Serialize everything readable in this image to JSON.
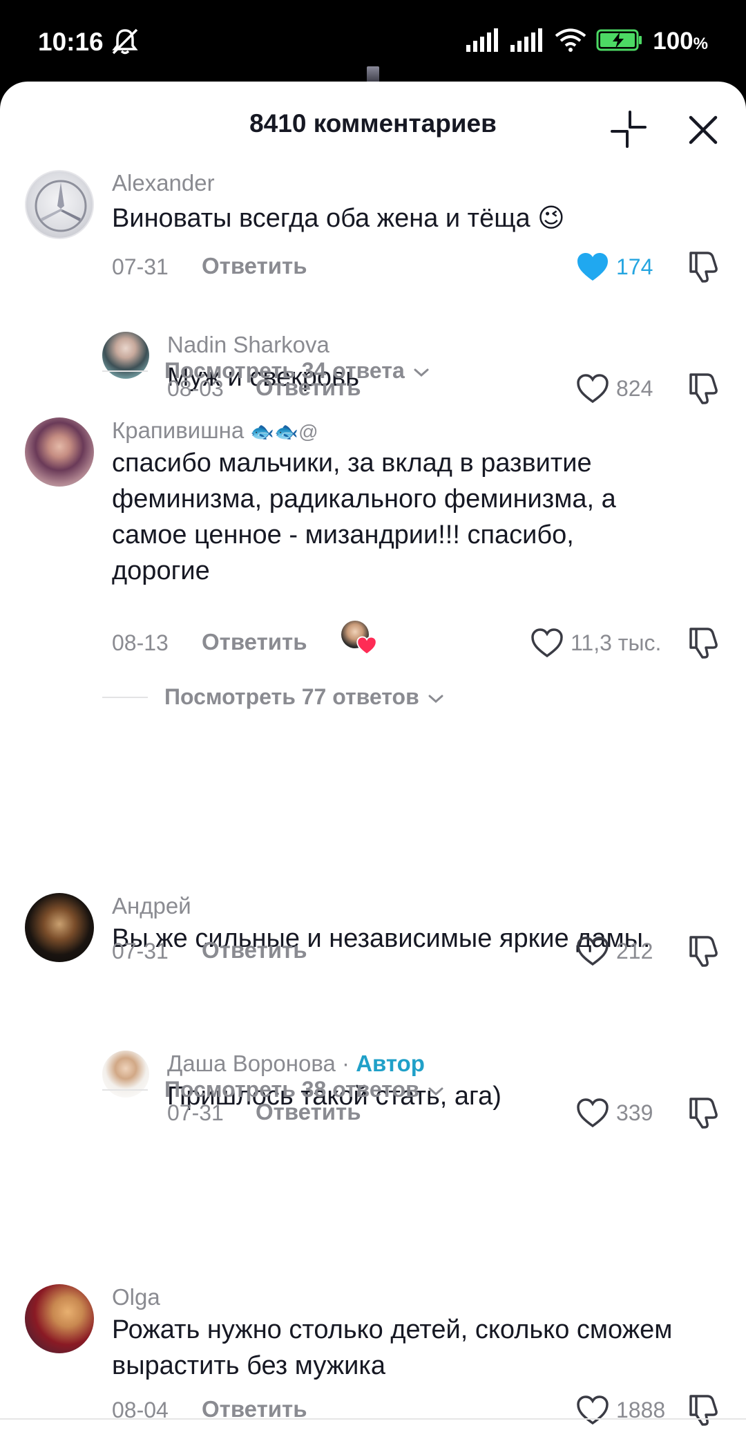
{
  "status": {
    "time": "10:16",
    "battery": "100",
    "battery_unit": "%"
  },
  "header": {
    "title": "8410 комментариев"
  },
  "reply_label": "Ответить",
  "comments": [
    {
      "user": "Alexander",
      "text": "Виноваты всегда оба жена и тёща 😉",
      "date": "07-31",
      "likes": "174",
      "liked": true
    },
    {
      "user": "Nadin Sharkova",
      "text": "Муж и свекровь",
      "date": "08-03",
      "likes": "824"
    },
    {
      "view_replies": "Посмотреть 34 ответа"
    },
    {
      "user": "Крапивишна",
      "user_suffix": "🐟🐟@",
      "text": "спасибо мальчики, за вклад в развитие феминизма, радикального феминизма, а самое ценное - мизандрии!!! спасибо, дорогие",
      "date": "08-13",
      "likes": "11,3 тыс."
    },
    {
      "view_replies": "Посмотреть 77 ответов"
    },
    {
      "user": "Андрей",
      "text": "Вы же сильные и независимые яркие дамы.",
      "date": "07-31",
      "likes": "212"
    },
    {
      "user": "Даша Воронова",
      "author_sep": " · ",
      "author_badge": "Автор",
      "text": "Пришлось такой стать, ага)",
      "date": "07-31",
      "likes": "339"
    },
    {
      "view_replies": "Посмотреть 38 ответов"
    },
    {
      "user": "Olga",
      "text": "Рожать нужно столько детей, сколько сможем вырастить без мужика",
      "date": "08-04",
      "likes": "1888"
    }
  ],
  "colors": {
    "accent_blue": "#25a5e0",
    "author_badge": "#20a0c8",
    "liked_heart": "#20a8f0",
    "gray_text": "#8a8b91"
  },
  "icons": [
    "mute-icon",
    "signal-icon",
    "wifi-icon",
    "battery-charging-icon",
    "collapse-icon",
    "close-icon",
    "heart-icon",
    "dislike-icon",
    "chevron-down-icon"
  ]
}
